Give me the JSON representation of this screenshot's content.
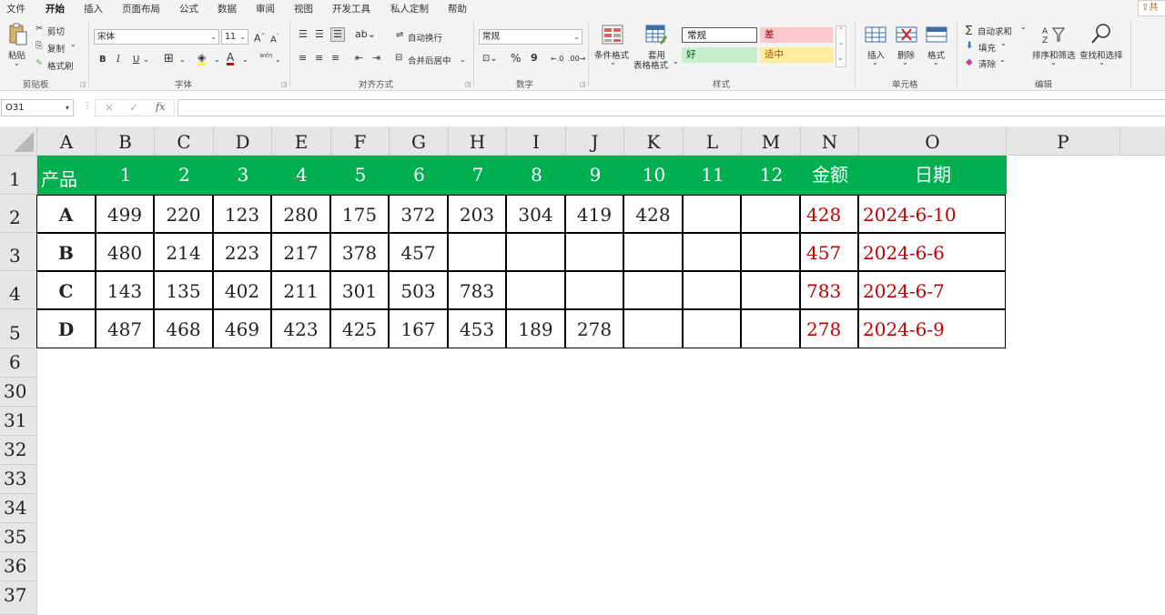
{
  "ribbon_tabs": [
    "文件",
    "开始",
    "插入",
    "页面布局",
    "公式",
    "数据",
    "审阅",
    "视图",
    "开发工具",
    "私人定制",
    "帮助"
  ],
  "active_tab": "开始",
  "share_label": "共",
  "clipboard": {
    "paste": "粘贴",
    "cut": "剪切",
    "copy": "复制",
    "format_painter": "格式刷",
    "group": "剪贴板"
  },
  "font": {
    "name": "宋体",
    "size": "11",
    "bold": "B",
    "italic": "I",
    "underline": "U",
    "font_color_glyph": "A",
    "phonetic": "wén",
    "group": "字体"
  },
  "alignment": {
    "wrap": "自动换行",
    "merge": "合并后居中",
    "group": "对齐方式"
  },
  "number": {
    "format": "常规",
    "percent": "%",
    "comma": "9",
    "group": "数字"
  },
  "styles": {
    "conditional": "条件格式",
    "table1": "套用",
    "table2": "表格格式",
    "normal": "常规",
    "bad": "差",
    "good": "好",
    "neutral": "适中",
    "group": "样式"
  },
  "cells_group": {
    "insert": "插入",
    "delete": "删除",
    "format": "格式",
    "group": "单元格"
  },
  "editing": {
    "autosum": "自动求和",
    "fill": "填充",
    "clear": "清除",
    "sort": "排序和筛选",
    "find": "查找和选择",
    "group": "编辑"
  },
  "formula_bar": {
    "name_box": "O31",
    "cancel": "×",
    "enter": "✓",
    "fx": "fx",
    "formula": ""
  },
  "colors": {
    "header_green": "#00b050",
    "value_red": "#c00000",
    "gridline": "#000000"
  },
  "columns": [
    "A",
    "B",
    "C",
    "D",
    "E",
    "F",
    "G",
    "H",
    "I",
    "J",
    "K",
    "L",
    "M",
    "N",
    "O",
    "P"
  ],
  "row_numbers": [
    "1",
    "2",
    "3",
    "4",
    "5",
    "6",
    "30",
    "31",
    "32",
    "33",
    "34",
    "35",
    "36",
    "37"
  ],
  "table": {
    "header": [
      "产品",
      "1",
      "2",
      "3",
      "4",
      "5",
      "6",
      "7",
      "8",
      "9",
      "10",
      "11",
      "12",
      "金额",
      "日期"
    ],
    "rows": [
      [
        "A",
        "499",
        "220",
        "123",
        "280",
        "175",
        "372",
        "203",
        "304",
        "419",
        "428",
        "",
        "",
        "428",
        "2024-6-10"
      ],
      [
        "B",
        "480",
        "214",
        "223",
        "217",
        "378",
        "457",
        "",
        "",
        "",
        "",
        "",
        "",
        "457",
        "2024-6-6"
      ],
      [
        "C",
        "143",
        "135",
        "402",
        "211",
        "301",
        "503",
        "783",
        "",
        "",
        "",
        "",
        "",
        "783",
        "2024-6-7"
      ],
      [
        "D",
        "487",
        "468",
        "469",
        "423",
        "425",
        "167",
        "453",
        "189",
        "278",
        "",
        "",
        "",
        "278",
        "2024-6-9"
      ]
    ]
  }
}
